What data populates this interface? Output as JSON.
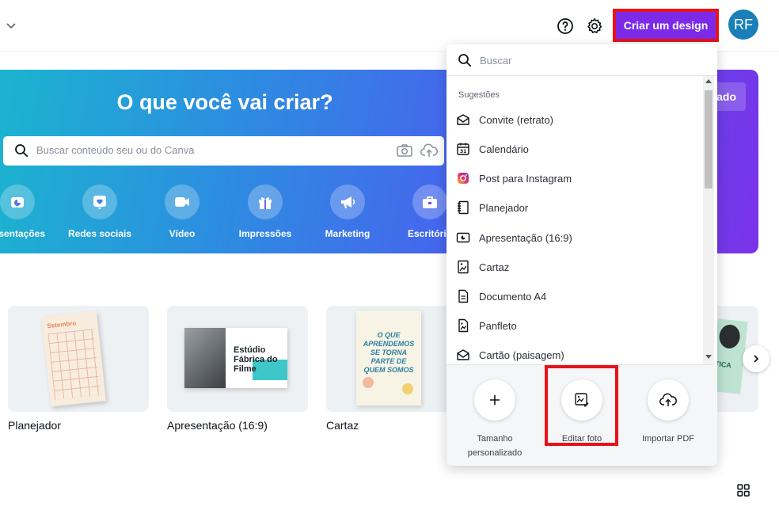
{
  "topbar": {
    "create_button": "Criar um design",
    "avatar_initials": "RF"
  },
  "hero": {
    "title": "O que você vai criar?",
    "search_placeholder": "Buscar conteúdo seu ou do Canva",
    "partial_button": "ado",
    "categories": [
      {
        "label": "resentações",
        "icon": "presentation-icon"
      },
      {
        "label": "Redes sociais",
        "icon": "heart-icon"
      },
      {
        "label": "Vídeo",
        "icon": "video-icon"
      },
      {
        "label": "Impressões",
        "icon": "gift-icon"
      },
      {
        "label": "Marketing",
        "icon": "megaphone-icon"
      },
      {
        "label": "Escritório",
        "icon": "briefcase-icon"
      }
    ]
  },
  "templates": [
    {
      "label": "Planejador",
      "thumb_text": "Setembro"
    },
    {
      "label": "Apresentação (16:9)",
      "thumb_text": "Estúdio Fábrica do Filme"
    },
    {
      "label": "Cartaz",
      "thumb_text": "O QUE APRENDEMOS SE TORNA PARTE DE QUEM SOMOS"
    },
    {
      "label": "",
      "thumb_text": "TICA"
    }
  ],
  "dropdown": {
    "search_placeholder": "Buscar",
    "heading": "Sugestões",
    "items": [
      {
        "label": "Convite (retrato)",
        "icon": "envelope-icon"
      },
      {
        "label": "Calendário",
        "icon": "calendar-icon"
      },
      {
        "label": "Post para Instagram",
        "icon": "instagram-icon"
      },
      {
        "label": "Planejador",
        "icon": "planner-icon"
      },
      {
        "label": "Apresentação (16:9)",
        "icon": "presentation-icon"
      },
      {
        "label": "Cartaz",
        "icon": "poster-icon"
      },
      {
        "label": "Documento A4",
        "icon": "document-icon"
      },
      {
        "label": "Panfleto",
        "icon": "flyer-icon"
      },
      {
        "label": "Cartão (paisagem)",
        "icon": "card-icon"
      }
    ],
    "actions": [
      {
        "label": "Tamanho personalizado",
        "icon": "plus-icon"
      },
      {
        "label": "Editar foto",
        "icon": "image-edit-icon"
      },
      {
        "label": "Importar PDF",
        "icon": "cloud-upload-icon"
      }
    ]
  },
  "colors": {
    "accent": "#7d2ae8",
    "highlight": "#e8131a",
    "avatar": "#1a7fb8"
  }
}
